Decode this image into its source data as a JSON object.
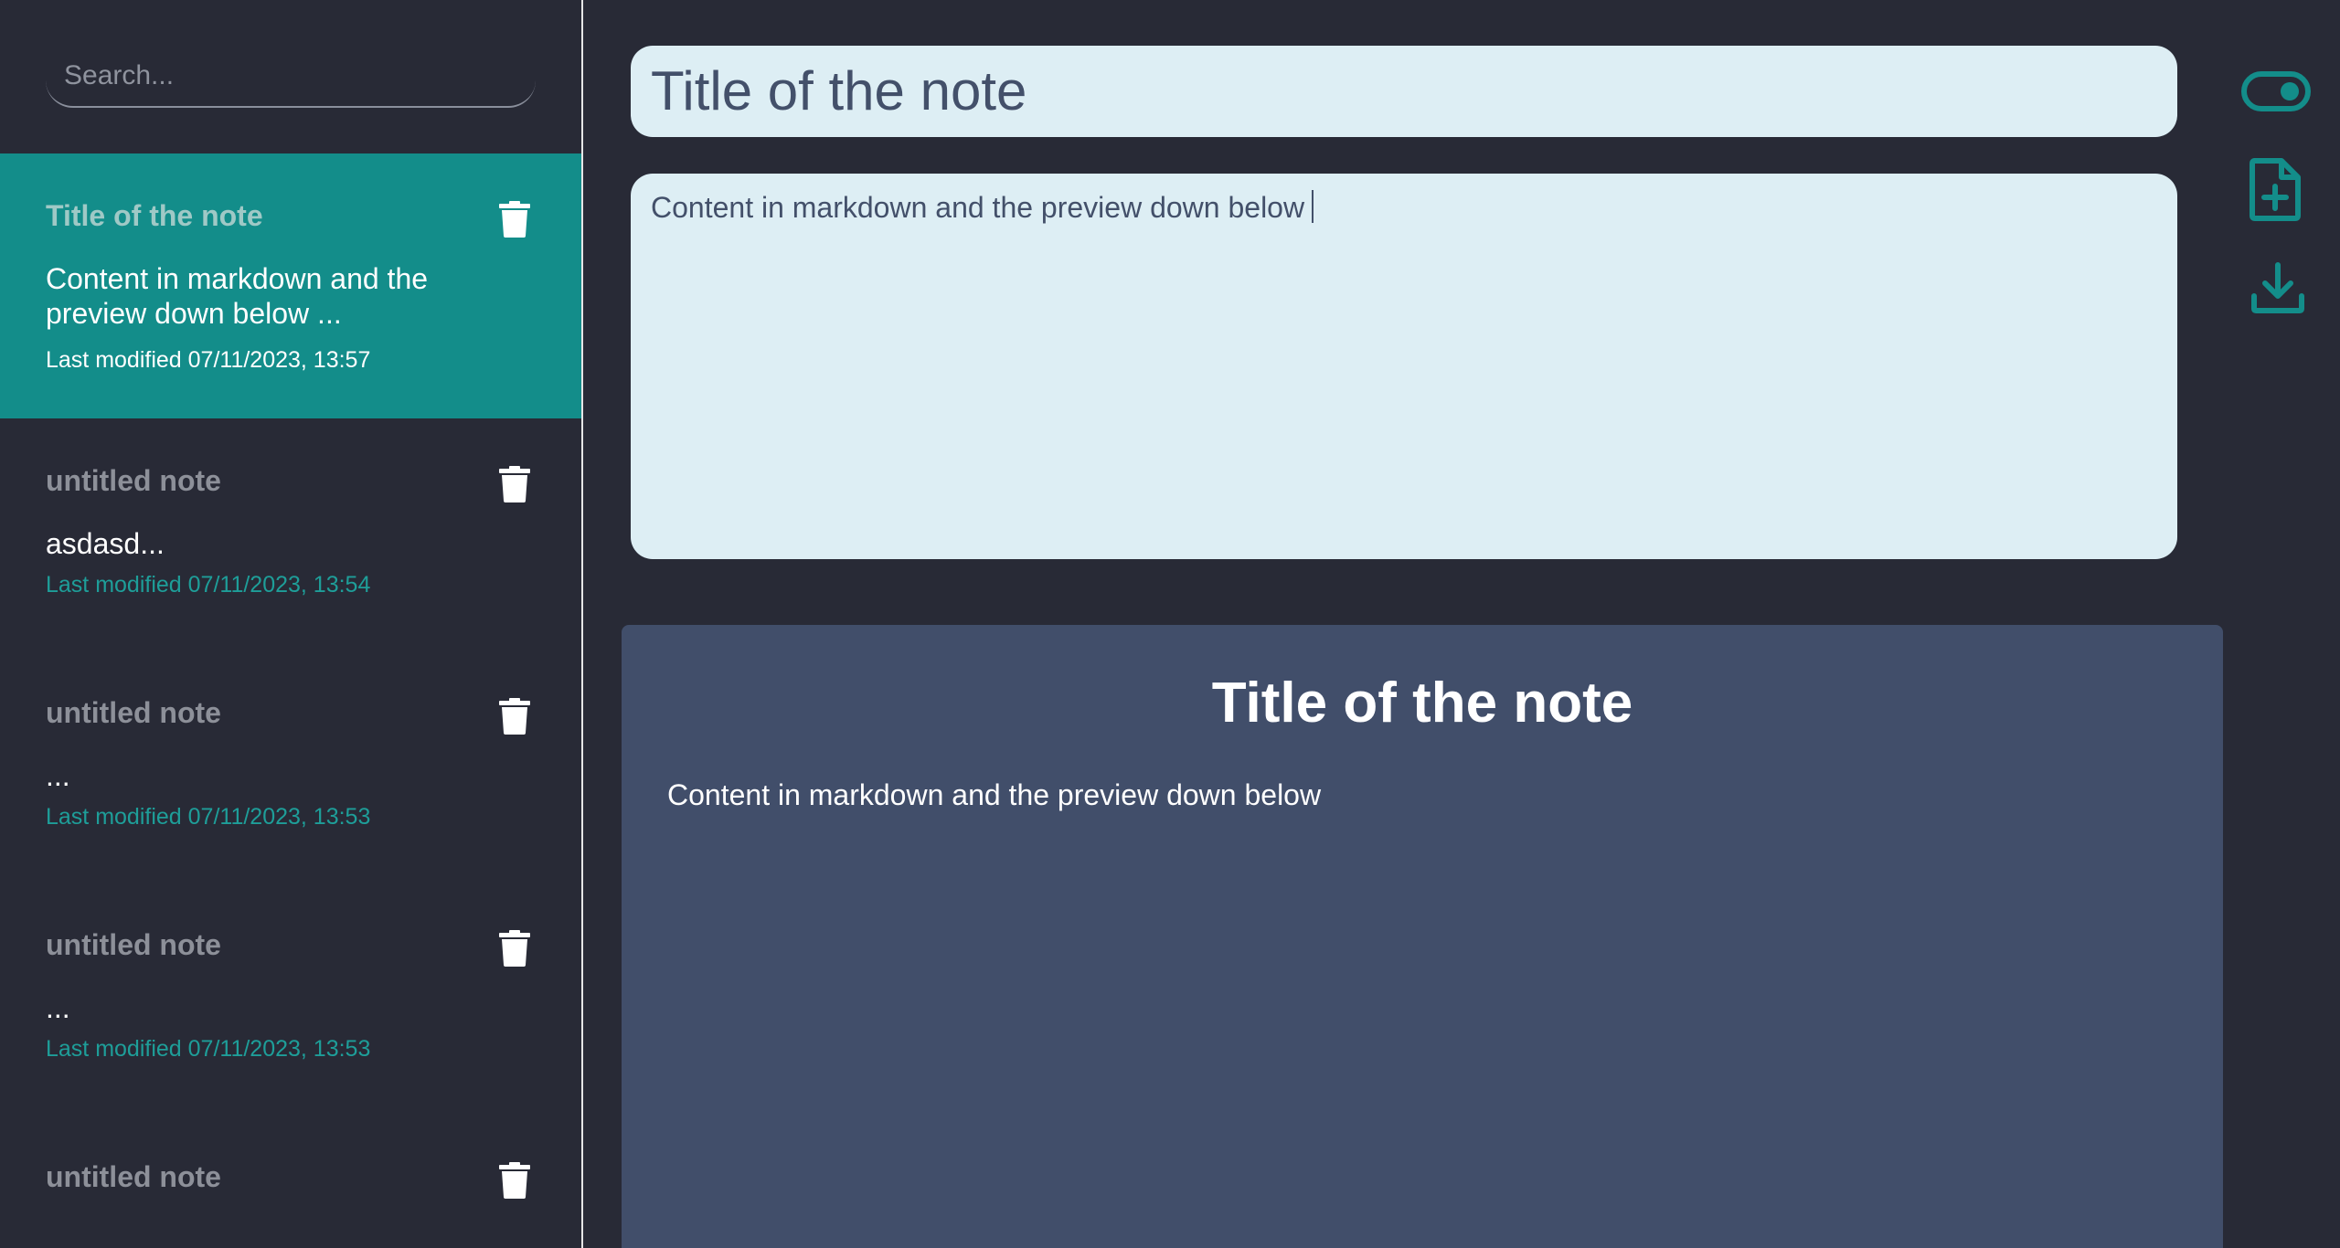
{
  "search": {
    "placeholder": "Search..."
  },
  "notes": [
    {
      "title": "Title of the note",
      "preview": "Content in markdown and the preview down below ...",
      "date": "Last modified 07/11/2023, 13:57"
    },
    {
      "title": "untitled note",
      "preview": "asdasd...",
      "date": "Last modified 07/11/2023, 13:54"
    },
    {
      "title": "untitled note",
      "preview": "...",
      "date": "Last modified 07/11/2023, 13:53"
    },
    {
      "title": "untitled note",
      "preview": "...",
      "date": "Last modified 07/11/2023, 13:53"
    },
    {
      "title": "untitled note",
      "preview": "",
      "date": ""
    }
  ],
  "editor": {
    "title_value": "Title of the note",
    "content_value": "Content in markdown and the preview down below"
  },
  "preview": {
    "heading": "Title of the note",
    "body": "Content in markdown and the preview down below"
  },
  "toolbar": {
    "icons": [
      "toggle-icon",
      "new-file-icon",
      "download-icon"
    ]
  },
  "colors": {
    "background": "#282a36",
    "accent": "#138d8a",
    "editor_bg": "#ddeef4",
    "preview_bg": "#414e6a"
  }
}
